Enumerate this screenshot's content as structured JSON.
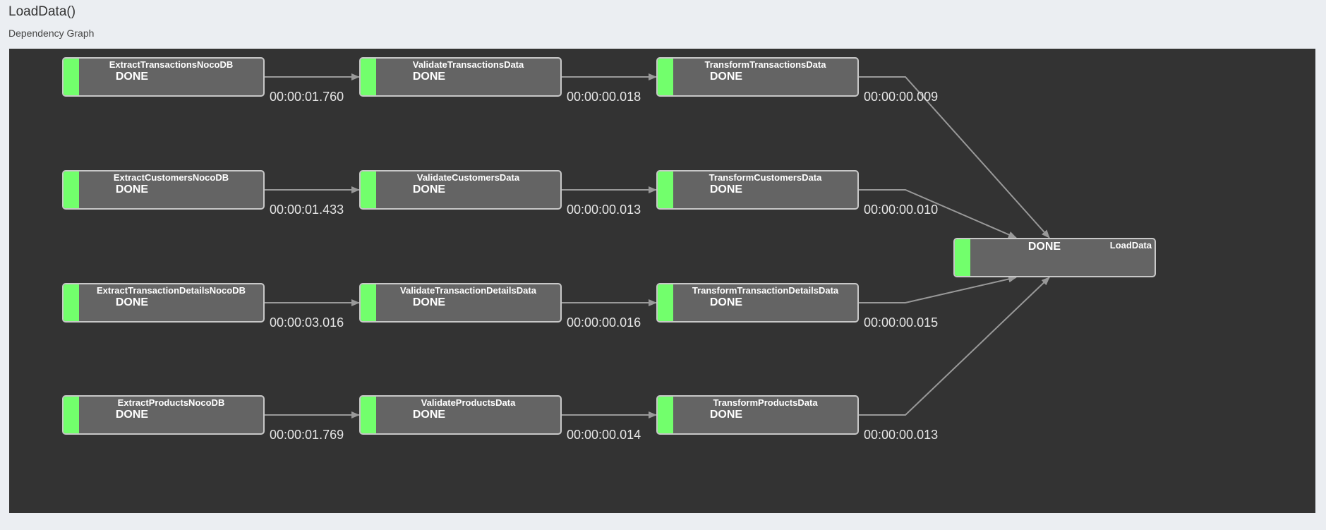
{
  "header": {
    "title": "LoadData()",
    "subtitle": "Dependency Graph"
  },
  "colors": {
    "canvas_background": "#333333",
    "node_fill": "#646464",
    "node_border": "#c8c8c8",
    "status_done": "#72ff6c",
    "edge": "#999999"
  },
  "graph": {
    "nodes": [
      {
        "id": "n0",
        "name": "ExtractTransactionsNocoDB",
        "status": "DONE",
        "duration": "00:00:01.760"
      },
      {
        "id": "n1",
        "name": "ValidateTransactionsData",
        "status": "DONE",
        "duration": "00:00:00.018"
      },
      {
        "id": "n2",
        "name": "TransformTransactionsData",
        "status": "DONE",
        "duration": "00:00:00.009"
      },
      {
        "id": "n3",
        "name": "ExtractCustomersNocoDB",
        "status": "DONE",
        "duration": "00:00:01.433"
      },
      {
        "id": "n4",
        "name": "ValidateCustomersData",
        "status": "DONE",
        "duration": "00:00:00.013"
      },
      {
        "id": "n5",
        "name": "TransformCustomersData",
        "status": "DONE",
        "duration": "00:00:00.010"
      },
      {
        "id": "n6",
        "name": "ExtractTransactionDetailsNocoDB",
        "status": "DONE",
        "duration": "00:00:03.016"
      },
      {
        "id": "n7",
        "name": "ValidateTransactionDetailsData",
        "status": "DONE",
        "duration": "00:00:00.016"
      },
      {
        "id": "n8",
        "name": "TransformTransactionDetailsData",
        "status": "DONE",
        "duration": "00:00:00.015"
      },
      {
        "id": "n9",
        "name": "ExtractProductsNocoDB",
        "status": "DONE",
        "duration": "00:00:01.769"
      },
      {
        "id": "n10",
        "name": "ValidateProductsData",
        "status": "DONE",
        "duration": "00:00:00.014"
      },
      {
        "id": "n11",
        "name": "TransformProductsData",
        "status": "DONE",
        "duration": "00:00:00.013"
      },
      {
        "id": "n12",
        "name": "LoadData",
        "status": "DONE"
      }
    ],
    "edges": [
      [
        "n0",
        "n1"
      ],
      [
        "n1",
        "n2"
      ],
      [
        "n2",
        "n12"
      ],
      [
        "n3",
        "n4"
      ],
      [
        "n4",
        "n5"
      ],
      [
        "n5",
        "n12"
      ],
      [
        "n6",
        "n7"
      ],
      [
        "n7",
        "n8"
      ],
      [
        "n8",
        "n12"
      ],
      [
        "n9",
        "n10"
      ],
      [
        "n10",
        "n11"
      ],
      [
        "n11",
        "n12"
      ]
    ]
  }
}
